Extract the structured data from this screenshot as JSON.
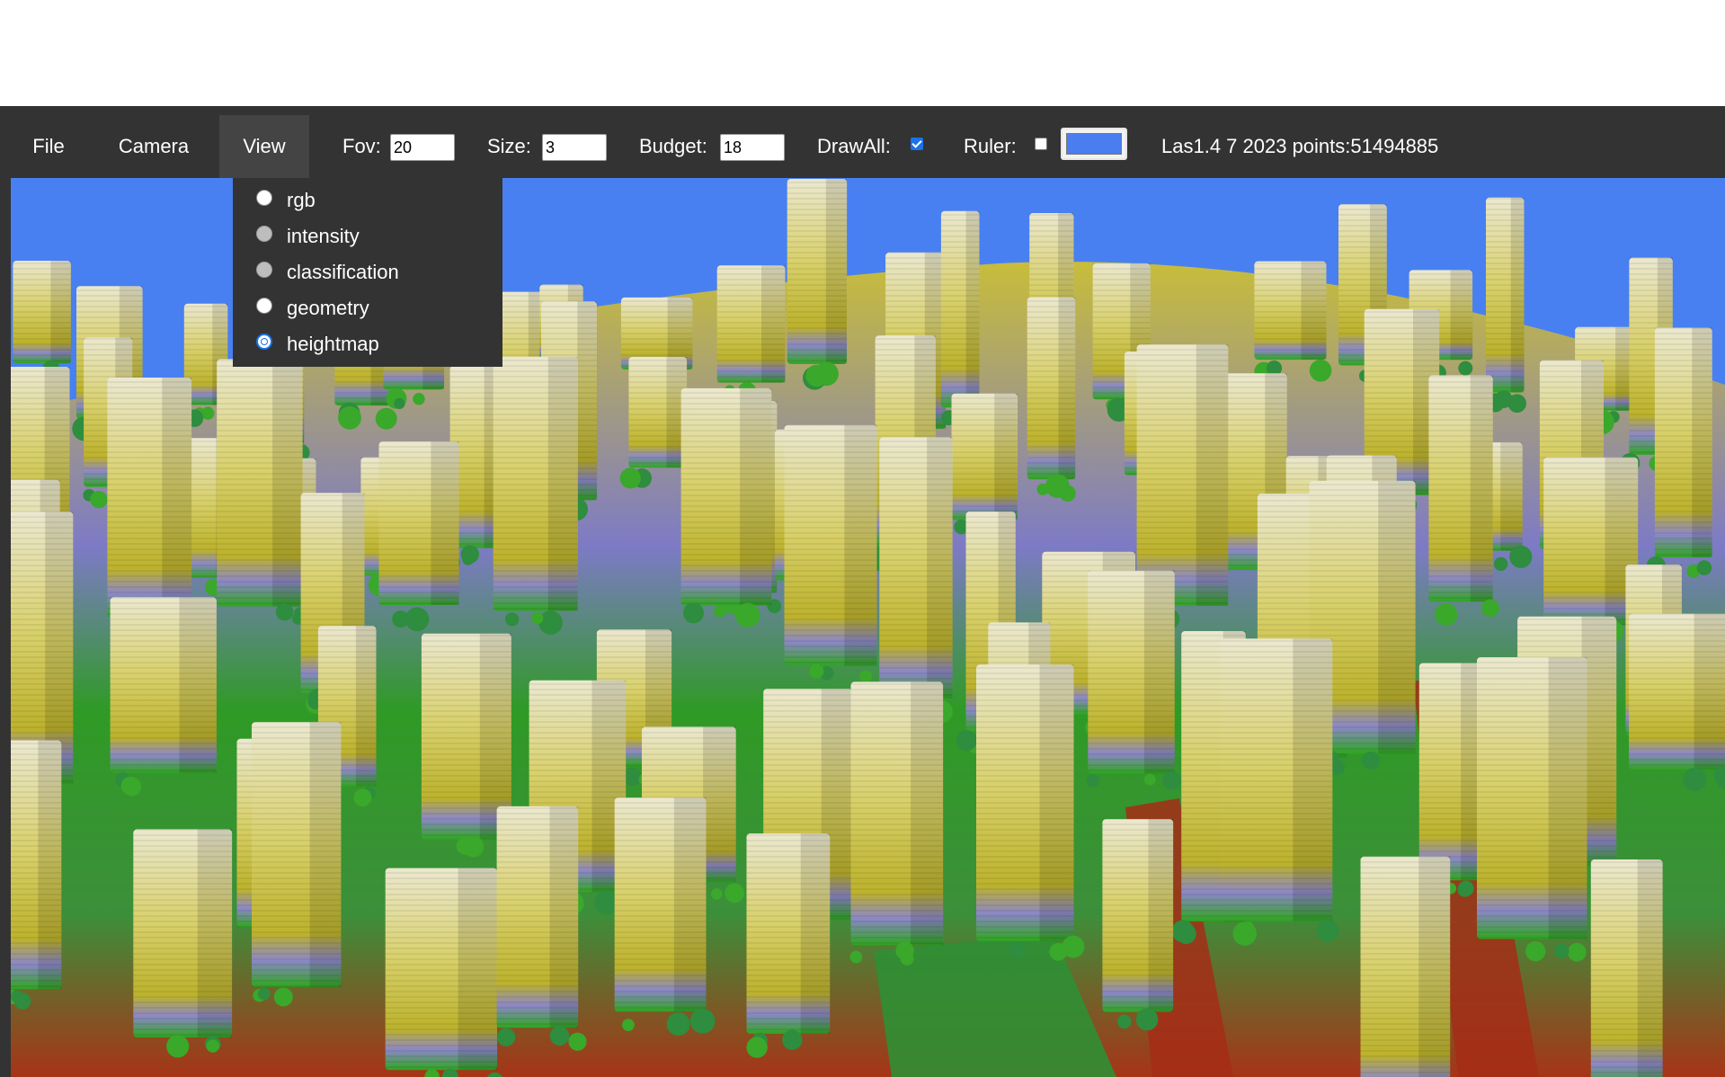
{
  "toolbar": {
    "menus": {
      "file": "File",
      "camera": "Camera",
      "view": "View"
    },
    "fov": {
      "label": "Fov:",
      "value": "20"
    },
    "size": {
      "label": "Size:",
      "value": "3"
    },
    "budget": {
      "label": "Budget:",
      "value": "18"
    },
    "drawall": {
      "label": "DrawAll:",
      "checked": true
    },
    "ruler": {
      "label": "Ruler:",
      "checked": false,
      "color": "#4a7df0"
    },
    "status": "Las1.4 7 2023 points:51494885"
  },
  "view_menu": {
    "options": [
      {
        "label": "rgb",
        "state": "enabled"
      },
      {
        "label": "intensity",
        "state": "disabled"
      },
      {
        "label": "classification",
        "state": "disabled"
      },
      {
        "label": "geometry",
        "state": "enabled"
      },
      {
        "label": "heightmap",
        "state": "selected"
      }
    ]
  },
  "colors": {
    "toolbar_bg": "#333333",
    "sky": "#4880f2",
    "building_high": "#e8e6c4",
    "building_mid": "#cfc440",
    "vegetation": "#2ea61e",
    "ground_low": "#b52a14",
    "band_violet": "#7b78c9"
  },
  "icons": {
    "radio": "radio-button",
    "check": "checkbox",
    "color": "color-swatch"
  }
}
